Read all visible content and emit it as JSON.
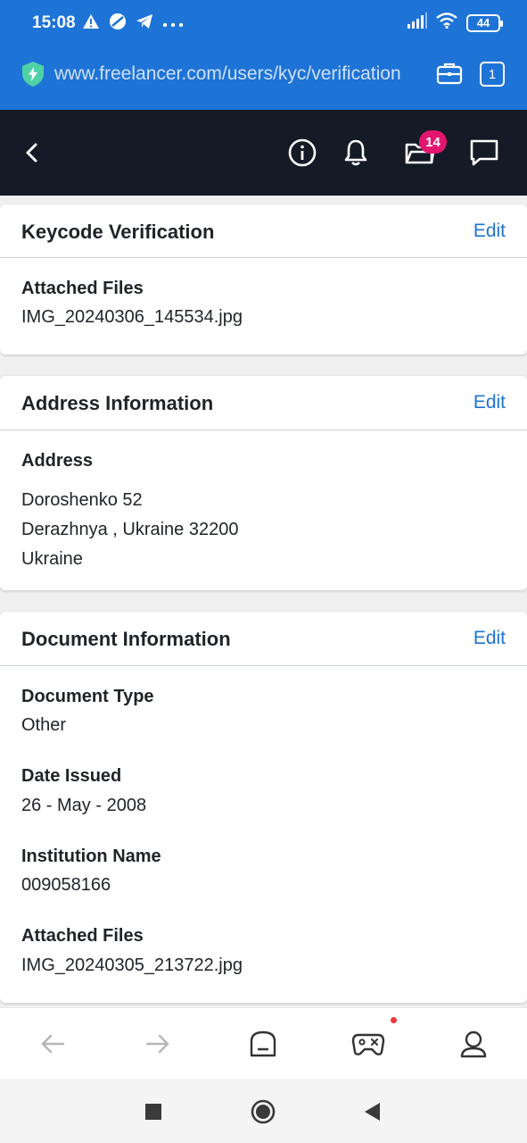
{
  "status_bar": {
    "time": "15:08",
    "battery": "44"
  },
  "browser": {
    "url": "www.freelancer.com/users/kyc/verification",
    "tab_count": "1"
  },
  "header": {
    "notification_badge": "14"
  },
  "cards": {
    "keycode": {
      "title": "Keycode Verification",
      "edit": "Edit",
      "attached_label": "Attached Files",
      "attached_value": "IMG_20240306_145534.jpg"
    },
    "address": {
      "title": "Address Information",
      "edit": "Edit",
      "address_label": "Address",
      "line1": "Doroshenko 52",
      "line2": "Derazhnya , Ukraine 32200",
      "line3": "Ukraine"
    },
    "document": {
      "title": "Document Information",
      "edit": "Edit",
      "type_label": "Document Type",
      "type_value": "Other",
      "date_label": "Date Issued",
      "date_value": "26 - May - 2008",
      "institution_label": "Institution Name",
      "institution_value": "009058166",
      "attached_label": "Attached Files",
      "attached_value": "IMG_20240305_213722.jpg"
    }
  },
  "colors": {
    "browser_blue": "#1e73d6",
    "header_dark": "#141a26",
    "badge_pink": "#e3156f",
    "link_blue": "#1e73d6"
  },
  "icons": [
    "warning-icon",
    "no-entry-icon",
    "telegram-icon",
    "more-icon",
    "signal-icon",
    "wifi-icon",
    "shield-icon",
    "briefcase-icon",
    "back-icon",
    "info-icon",
    "bell-icon",
    "folder-icon",
    "chat-icon",
    "arrow-left-icon",
    "arrow-right-icon",
    "home-icon",
    "gamepad-icon",
    "profile-icon",
    "square-icon",
    "circle-icon",
    "triangle-back-icon"
  ]
}
